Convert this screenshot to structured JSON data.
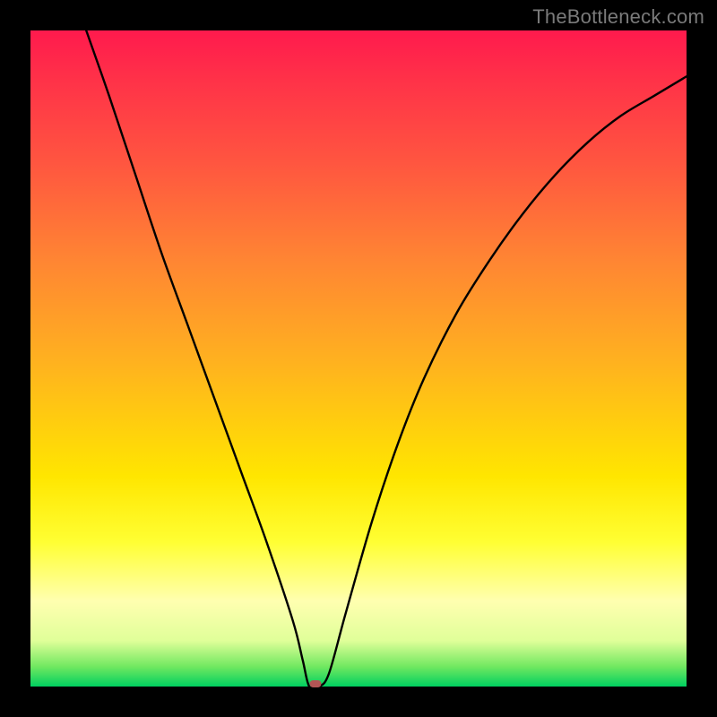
{
  "watermark": "TheBottleneck.com",
  "chart_data": {
    "type": "line",
    "title": "",
    "xlabel": "",
    "ylabel": "",
    "xlim": [
      0,
      1
    ],
    "ylim": [
      0,
      1
    ],
    "marker": {
      "x": 0.435,
      "y": 0.0
    },
    "series": [
      {
        "name": "curve",
        "x": [
          0.085,
          0.12,
          0.16,
          0.2,
          0.24,
          0.28,
          0.32,
          0.36,
          0.4,
          0.415,
          0.425,
          0.44,
          0.455,
          0.48,
          0.52,
          0.56,
          0.6,
          0.65,
          0.7,
          0.75,
          0.8,
          0.85,
          0.9,
          0.95,
          1.0
        ],
        "y": [
          1.0,
          0.9,
          0.78,
          0.66,
          0.55,
          0.44,
          0.33,
          0.22,
          0.1,
          0.04,
          0.0,
          0.0,
          0.02,
          0.11,
          0.25,
          0.37,
          0.47,
          0.57,
          0.65,
          0.72,
          0.78,
          0.83,
          0.87,
          0.9,
          0.93
        ]
      }
    ],
    "gradient_stops": [
      {
        "pos": 0.0,
        "color": "#ff1a4d"
      },
      {
        "pos": 0.5,
        "color": "#ffe600"
      },
      {
        "pos": 1.0,
        "color": "#00d060"
      }
    ]
  }
}
